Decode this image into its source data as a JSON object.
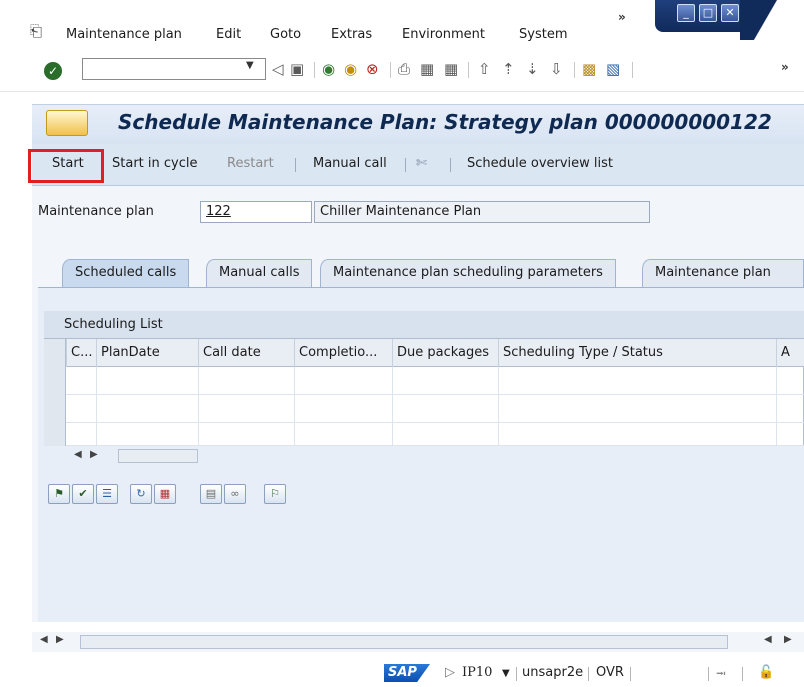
{
  "menubar": {
    "items": [
      "Maintenance plan",
      "Edit",
      "Goto",
      "Extras",
      "Environment",
      "System"
    ]
  },
  "toolbar": {
    "command_value": ""
  },
  "title": {
    "text": "Schedule Maintenance Plan: Strategy plan 000000000122"
  },
  "app_toolbar": {
    "start": "Start",
    "start_in_cycle": "Start in cycle",
    "restart": "Restart",
    "manual_call": "Manual call",
    "schedule_overview_list": "Schedule overview list"
  },
  "form": {
    "plan_label": "Maintenance plan",
    "plan_value": "122",
    "plan_desc": "Chiller Maintenance Plan"
  },
  "tabs": [
    {
      "label": "Scheduled calls",
      "active": true
    },
    {
      "label": "Manual calls",
      "active": false
    },
    {
      "label": "Maintenance plan scheduling parameters",
      "active": false
    },
    {
      "label": "Maintenance plan",
      "active": false
    }
  ],
  "table": {
    "title": "Scheduling List",
    "columns": [
      "C...",
      "PlanDate",
      "Call date",
      "Completio...",
      "Due packages",
      "Scheduling Type / Status",
      "A"
    ]
  },
  "statusbar": {
    "logo": "SAP",
    "system": "IP10",
    "host": "unsapr2e",
    "mode": "OVR"
  },
  "colors": {
    "highlight": "#e02020",
    "title_text": "#0f2a52",
    "toolbar_bg": "#dbe6f3"
  }
}
